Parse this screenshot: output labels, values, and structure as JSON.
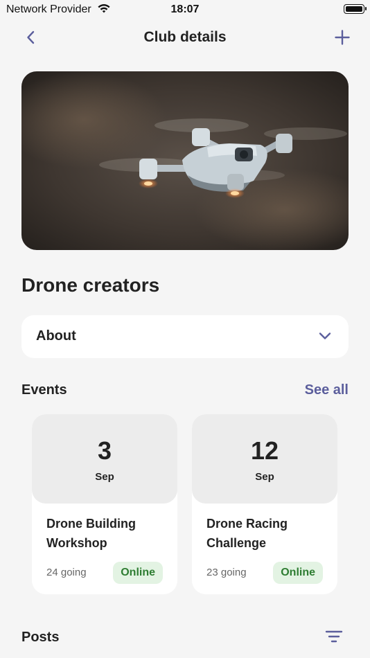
{
  "status_bar": {
    "carrier": "Network Provider",
    "time": "18:07"
  },
  "nav": {
    "title": "Club details"
  },
  "club": {
    "name": "Drone creators"
  },
  "about": {
    "label": "About"
  },
  "events": {
    "title": "Events",
    "see_all": "See all",
    "items": [
      {
        "day": "3",
        "month": "Sep",
        "title": "Drone Building Workshop",
        "going": "24 going",
        "badge": "Online"
      },
      {
        "day": "12",
        "month": "Sep",
        "title": "Drone Racing Challenge",
        "going": "23 going",
        "badge": "Online"
      }
    ]
  },
  "posts": {
    "title": "Posts"
  },
  "colors": {
    "accent": "#5b5e9c",
    "badge_bg": "#e3f3e3",
    "badge_text": "#2e7d32",
    "background": "#f5f5f5"
  }
}
